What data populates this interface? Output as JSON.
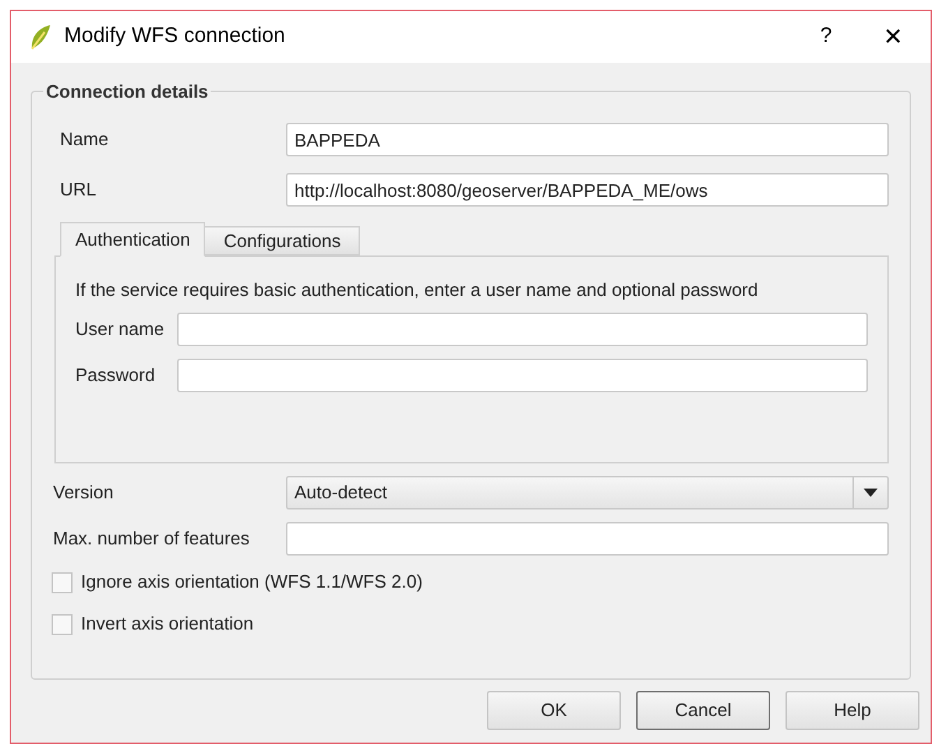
{
  "window": {
    "title": "Modify WFS connection",
    "help": "?",
    "close": "✕"
  },
  "group": {
    "title": "Connection details"
  },
  "fields": [
    {
      "label": "Name",
      "value": "BAPPEDA"
    },
    {
      "label": "URL",
      "value": "http://localhost:8080/geoserver/BAPPEDA_ME/ows"
    }
  ],
  "tabs": [
    {
      "label": "Authentication",
      "selected": true
    },
    {
      "label": "Configurations",
      "selected": false
    }
  ],
  "auth": {
    "hint": "If the service requires basic authentication, enter a user name and optional password",
    "fields": [
      {
        "label": "User name"
      },
      {
        "label": "Password"
      }
    ]
  },
  "version": {
    "label": "Version",
    "value": "Auto-detect"
  },
  "max_features": {
    "label": "Max. number of features"
  },
  "options": [
    {
      "label": "Ignore axis orientation (WFS 1.1/WFS 2.0)",
      "checked": false
    },
    {
      "label": "Invert axis orientation",
      "checked": false
    }
  ],
  "buttons": [
    {
      "label": "OK",
      "focused": false
    },
    {
      "label": "Cancel",
      "focused": true
    },
    {
      "label": "Help",
      "focused": false
    }
  ]
}
